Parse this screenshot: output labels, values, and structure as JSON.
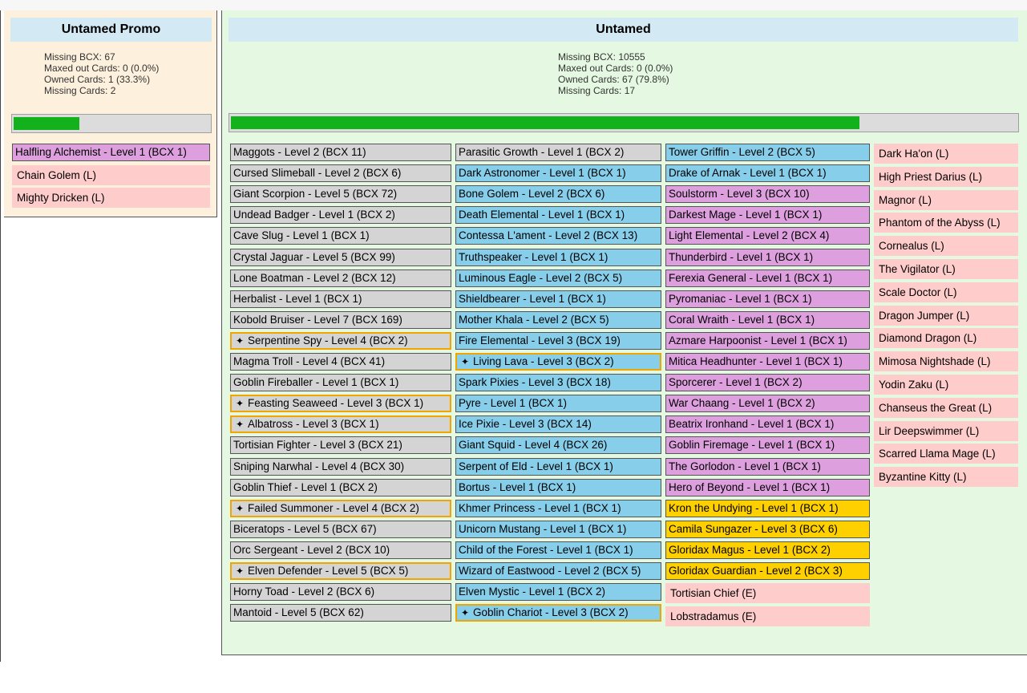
{
  "promo": {
    "title": "Untamed Promo",
    "stats": [
      "Missing BCX: 67",
      "Maxed out Cards: 0 (0.0%)",
      "Owned Cards: 1 (33.3%)",
      "Missing Cards: 2"
    ],
    "progress": 0.333,
    "cards": [
      {
        "text": "Halfling Alchemist - Level 1 (BCX 1)",
        "type": "purple"
      },
      {
        "text": "Chain Golem (L)",
        "type": "pink"
      },
      {
        "text": "Mighty Dricken (L)",
        "type": "pink"
      }
    ]
  },
  "untamed": {
    "title": "Untamed",
    "stats": [
      "Missing BCX: 10555",
      "Maxed out Cards: 0 (0.0%)",
      "Owned Cards: 67 (79.8%)",
      "Missing Cards: 17"
    ],
    "progress": 0.798,
    "columns": [
      [
        {
          "text": "Maggots - Level 2 (BCX 11)",
          "type": "gray"
        },
        {
          "text": "Cursed Slimeball - Level 2 (BCX 6)",
          "type": "gray"
        },
        {
          "text": "Giant Scorpion - Level 5 (BCX 72)",
          "type": "gray"
        },
        {
          "text": "Undead Badger - Level 1 (BCX 2)",
          "type": "gray"
        },
        {
          "text": "Cave Slug - Level 1 (BCX 1)",
          "type": "gray"
        },
        {
          "text": "Crystal Jaguar - Level 5 (BCX 99)",
          "type": "gray"
        },
        {
          "text": "Lone Boatman - Level 2 (BCX 12)",
          "type": "gray"
        },
        {
          "text": "Herbalist - Level 1 (BCX 1)",
          "type": "gray"
        },
        {
          "text": "Kobold Bruiser - Level 7 (BCX 169)",
          "type": "gray"
        },
        {
          "text": "Serpentine Spy - Level 4 (BCX 2)",
          "type": "gray",
          "star": true
        },
        {
          "text": "Magma Troll - Level 4 (BCX 41)",
          "type": "gray"
        },
        {
          "text": "Goblin Fireballer - Level 1 (BCX 1)",
          "type": "gray"
        },
        {
          "text": "Feasting Seaweed - Level 3 (BCX 1)",
          "type": "gray",
          "star": true
        },
        {
          "text": "Albatross - Level 3 (BCX 1)",
          "type": "gray",
          "star": true
        },
        {
          "text": "Tortisian Fighter - Level 3 (BCX 21)",
          "type": "gray"
        },
        {
          "text": "Sniping Narwhal - Level 4 (BCX 30)",
          "type": "gray"
        },
        {
          "text": "Goblin Thief - Level 1 (BCX 2)",
          "type": "gray"
        },
        {
          "text": "Failed Summoner - Level 4 (BCX 2)",
          "type": "gray",
          "star": true
        },
        {
          "text": "Biceratops - Level 5 (BCX 67)",
          "type": "gray"
        },
        {
          "text": "Orc Sergeant - Level 2 (BCX 10)",
          "type": "gray"
        },
        {
          "text": "Elven Defender - Level 5 (BCX 5)",
          "type": "gray",
          "star": true
        },
        {
          "text": "Horny Toad - Level 2 (BCX 6)",
          "type": "gray"
        },
        {
          "text": "Mantoid - Level 5 (BCX 62)",
          "type": "gray"
        }
      ],
      [
        {
          "text": "Parasitic Growth - Level 1 (BCX 2)",
          "type": "gray"
        },
        {
          "text": "Dark Astronomer - Level 1 (BCX 1)",
          "type": "blue"
        },
        {
          "text": "Bone Golem - Level 2 (BCX 6)",
          "type": "blue"
        },
        {
          "text": "Death Elemental - Level 1 (BCX 1)",
          "type": "blue"
        },
        {
          "text": "Contessa L'ament - Level 2 (BCX 13)",
          "type": "blue"
        },
        {
          "text": "Truthspeaker - Level 1 (BCX 1)",
          "type": "blue"
        },
        {
          "text": "Luminous Eagle - Level 2 (BCX 5)",
          "type": "blue"
        },
        {
          "text": "Shieldbearer - Level 1 (BCX 1)",
          "type": "blue"
        },
        {
          "text": "Mother Khala - Level 2 (BCX 5)",
          "type": "blue"
        },
        {
          "text": "Fire Elemental - Level 3 (BCX 19)",
          "type": "blue"
        },
        {
          "text": "Living Lava - Level 3 (BCX 2)",
          "type": "blue",
          "star": true
        },
        {
          "text": "Spark Pixies - Level 3 (BCX 18)",
          "type": "blue"
        },
        {
          "text": "Pyre - Level 1 (BCX 1)",
          "type": "blue"
        },
        {
          "text": "Ice Pixie - Level 3 (BCX 14)",
          "type": "blue"
        },
        {
          "text": "Giant Squid - Level 4 (BCX 26)",
          "type": "blue"
        },
        {
          "text": "Serpent of Eld - Level 1 (BCX 1)",
          "type": "blue"
        },
        {
          "text": "Bortus - Level 1 (BCX 1)",
          "type": "blue"
        },
        {
          "text": "Khmer Princess - Level 1 (BCX 1)",
          "type": "blue"
        },
        {
          "text": "Unicorn Mustang - Level 1 (BCX 1)",
          "type": "blue"
        },
        {
          "text": "Child of the Forest - Level 1 (BCX 1)",
          "type": "blue"
        },
        {
          "text": "Wizard of Eastwood - Level 2 (BCX 5)",
          "type": "blue"
        },
        {
          "text": "Elven Mystic - Level 1 (BCX 2)",
          "type": "blue"
        },
        {
          "text": "Goblin Chariot - Level 3 (BCX 2)",
          "type": "blue",
          "star": true
        }
      ],
      [
        {
          "text": "Tower Griffin - Level 2 (BCX 5)",
          "type": "blue"
        },
        {
          "text": "Drake of Arnak - Level 1 (BCX 1)",
          "type": "blue"
        },
        {
          "text": "Soulstorm - Level 3 (BCX 10)",
          "type": "purple"
        },
        {
          "text": "Darkest Mage - Level 1 (BCX 1)",
          "type": "purple"
        },
        {
          "text": "Light Elemental - Level 2 (BCX 4)",
          "type": "purple"
        },
        {
          "text": "Thunderbird - Level 1 (BCX 1)",
          "type": "purple"
        },
        {
          "text": "Ferexia General - Level 1 (BCX 1)",
          "type": "purple"
        },
        {
          "text": "Pyromaniac - Level 1 (BCX 1)",
          "type": "purple"
        },
        {
          "text": "Coral Wraith - Level 1 (BCX 1)",
          "type": "purple"
        },
        {
          "text": "Azmare Harpoonist - Level 1 (BCX 1)",
          "type": "purple"
        },
        {
          "text": "Mitica Headhunter - Level 1 (BCX 1)",
          "type": "purple"
        },
        {
          "text": "Sporcerer - Level 1 (BCX 2)",
          "type": "purple"
        },
        {
          "text": "War Chaang - Level 1 (BCX 2)",
          "type": "purple"
        },
        {
          "text": "Beatrix Ironhand - Level 1 (BCX 1)",
          "type": "purple"
        },
        {
          "text": "Goblin Firemage - Level 1 (BCX 1)",
          "type": "purple"
        },
        {
          "text": "The Gorlodon - Level 1 (BCX 1)",
          "type": "purple"
        },
        {
          "text": "Hero of Beyond - Level 1 (BCX 1)",
          "type": "purple"
        },
        {
          "text": "Kron the Undying - Level 1 (BCX 1)",
          "type": "gold"
        },
        {
          "text": "Camila Sungazer - Level 3 (BCX 6)",
          "type": "gold"
        },
        {
          "text": "Gloridax Magus - Level 1 (BCX 2)",
          "type": "gold"
        },
        {
          "text": "Gloridax Guardian - Level 2 (BCX 3)",
          "type": "gold"
        },
        {
          "text": "Tortisian Chief (E)",
          "type": "pink"
        },
        {
          "text": "Lobstradamus (E)",
          "type": "pink"
        }
      ],
      [
        {
          "text": "Dark Ha'on (L)",
          "type": "pink"
        },
        {
          "text": "High Priest Darius (L)",
          "type": "pink"
        },
        {
          "text": "Magnor (L)",
          "type": "pink"
        },
        {
          "text": "Phantom of the Abyss (L)",
          "type": "pink"
        },
        {
          "text": "Cornealus (L)",
          "type": "pink"
        },
        {
          "text": "The Vigilator (L)",
          "type": "pink"
        },
        {
          "text": "Scale Doctor (L)",
          "type": "pink"
        },
        {
          "text": "Dragon Jumper (L)",
          "type": "pink"
        },
        {
          "text": "Diamond Dragon (L)",
          "type": "pink"
        },
        {
          "text": "Mimosa Nightshade (L)",
          "type": "pink"
        },
        {
          "text": "Yodin Zaku (L)",
          "type": "pink"
        },
        {
          "text": "Chanseus the Great (L)",
          "type": "pink"
        },
        {
          "text": "Lir Deepswimmer (L)",
          "type": "pink"
        },
        {
          "text": "Scarred Llama Mage (L)",
          "type": "pink"
        },
        {
          "text": "Byzantine Kitty (L)",
          "type": "pink"
        }
      ]
    ]
  }
}
